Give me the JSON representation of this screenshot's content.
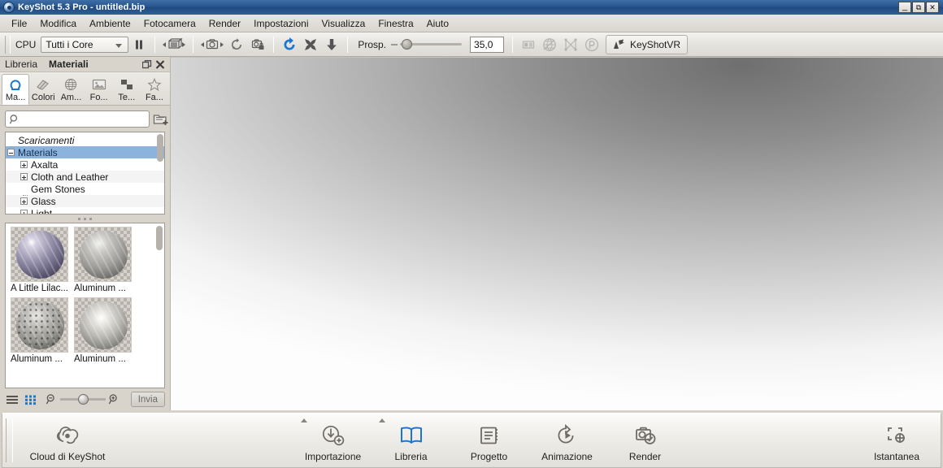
{
  "window": {
    "app_name": "KeyShot 5.3 Pro",
    "document": "untitled.bip",
    "title": "KeyShot 5.3 Pro  - untitled.bip",
    "minimize_label": "_",
    "restore_label": "❐",
    "close_label": "✕"
  },
  "menubar": {
    "items": [
      {
        "label": "File"
      },
      {
        "label": "Modifica"
      },
      {
        "label": "Ambiente"
      },
      {
        "label": "Fotocamera"
      },
      {
        "label": "Render"
      },
      {
        "label": "Impostazioni"
      },
      {
        "label": "Visualizza"
      },
      {
        "label": "Finestra"
      },
      {
        "label": "Aiuto"
      }
    ]
  },
  "toolbar": {
    "cpu_label": "CPU",
    "cores_value": "Tutti i Core",
    "pause_tooltip": "Pausa",
    "library_nav_tooltip": "Libreria materiali",
    "camera_nav_tooltip": "Fotocamera",
    "refresh_tooltip": "Aggiorna",
    "lock_tooltip": "Blocca fotocamera",
    "render_tooltip": "Render",
    "fullscreen_tooltip": "Schermo intero",
    "download_tooltip": "Scarica",
    "perspective_label": "Prosp.",
    "perspective_value": "35,0",
    "panel_tooltip": "Pannello",
    "environment_tooltip": "Ambiente",
    "geometry_tooltip": "Geometria",
    "spin_tooltip": "Rotazione",
    "keyshotvr_label": "KeyShotVR"
  },
  "panel": {
    "header": {
      "tab_library": "Libreria",
      "tab_materials": "Materiali",
      "float_icon": "float-icon",
      "close_icon": "close-icon"
    },
    "tabs": [
      {
        "label": "Ma...",
        "full": "Materiali",
        "icon": "material-icon",
        "active": true
      },
      {
        "label": "Colori",
        "full": "Colori",
        "icon": "colors-icon",
        "active": false
      },
      {
        "label": "Am...",
        "full": "Ambienti",
        "icon": "environment-icon",
        "active": false
      },
      {
        "label": "Fo...",
        "full": "Fondali",
        "icon": "backplate-icon",
        "active": false
      },
      {
        "label": "Te...",
        "full": "Texture",
        "icon": "texture-icon",
        "active": false
      },
      {
        "label": "Fa...",
        "full": "Favoriti",
        "icon": "favorites-icon",
        "active": false
      }
    ],
    "search": {
      "placeholder": "",
      "value": "",
      "icon": "search-icon",
      "add_folder_icon": "add-folder-icon",
      "folder_options_icon": "folder-options-icon"
    },
    "tree": [
      {
        "label": "Scaricamenti",
        "indent": 0,
        "expander": "none",
        "italic": true,
        "selected": false
      },
      {
        "label": "Materials",
        "indent": 0,
        "expander": "minus",
        "italic": false,
        "selected": true
      },
      {
        "label": "Axalta",
        "indent": 1,
        "expander": "plus",
        "italic": false,
        "selected": false
      },
      {
        "label": "Cloth and Leather",
        "indent": 1,
        "expander": "plus",
        "italic": false,
        "selected": false
      },
      {
        "label": "Gem Stones",
        "indent": 1,
        "expander": "none",
        "italic": false,
        "selected": false
      },
      {
        "label": "Glass",
        "indent": 1,
        "expander": "plus",
        "italic": false,
        "selected": false
      },
      {
        "label": "Light",
        "indent": 1,
        "expander": "plus",
        "italic": false,
        "selected": false
      }
    ],
    "materials": [
      {
        "name": "A Little Lilac...",
        "sphere": "sp1"
      },
      {
        "name": "Aluminum ...",
        "sphere": "sp2"
      },
      {
        "name": "Aluminum ...",
        "sphere": "sp3"
      },
      {
        "name": "Aluminum ...",
        "sphere": "sp4"
      }
    ],
    "footer": {
      "list_view_icon": "list-view-icon",
      "grid_view_icon": "grid-view-icon",
      "zoom_out_icon": "zoom-out-icon",
      "zoom_in_icon": "zoom-in-icon",
      "send_label": "Invia"
    }
  },
  "dock": {
    "left": [
      {
        "label": "Cloud di KeyShot",
        "icon": "cloud-icon",
        "active": false,
        "caret": false,
        "width": 140
      }
    ],
    "center": [
      {
        "label": "Importazione",
        "icon": "import-icon",
        "active": false,
        "caret": true
      },
      {
        "label": "Libreria",
        "icon": "library-icon",
        "active": true,
        "caret": true
      },
      {
        "label": "Progetto",
        "icon": "project-icon",
        "active": false,
        "caret": false
      },
      {
        "label": "Animazione",
        "icon": "animation-icon",
        "active": false,
        "caret": false
      },
      {
        "label": "Render",
        "icon": "render-icon",
        "active": false,
        "caret": false
      }
    ],
    "right": [
      {
        "label": "Istantanea",
        "icon": "snapshot-icon",
        "active": false,
        "caret": false
      }
    ]
  },
  "colors": {
    "title_bar": "#27558c",
    "accent_blue": "#1b76d2",
    "selection_blue": "#8cb3dd",
    "chrome_gray": "#d6d2ca"
  }
}
